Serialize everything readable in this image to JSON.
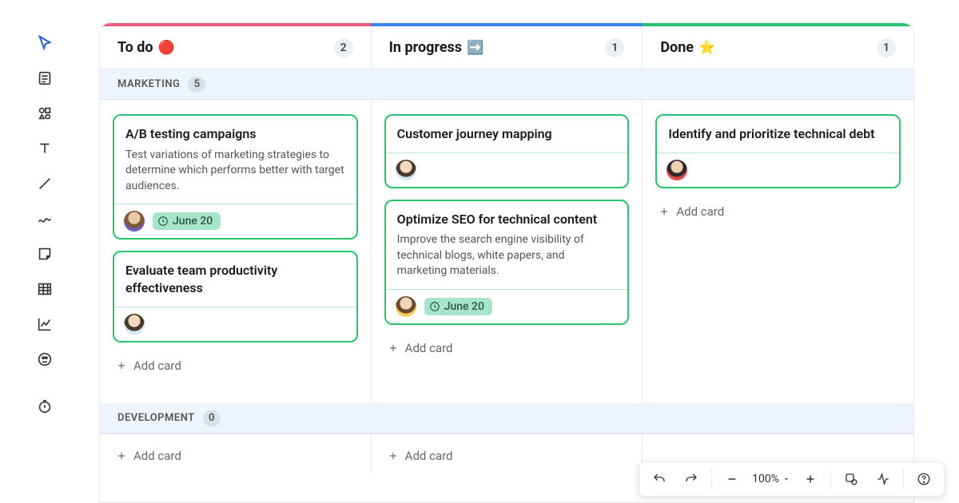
{
  "sidebar": {
    "tools": [
      "cursor",
      "notes",
      "shapes",
      "text",
      "line",
      "draw",
      "sticky",
      "table",
      "chart",
      "stamp",
      "timer"
    ]
  },
  "columns": [
    {
      "title": "To do",
      "emoji": "🔴",
      "count": "2",
      "strip_color": "#ef5b7f"
    },
    {
      "title": "In progress",
      "emoji": "➡️",
      "count": "1",
      "strip_color": "#3a83f5"
    },
    {
      "title": "Done",
      "emoji": "⭐",
      "count": "1",
      "strip_color": "#29c46d"
    }
  ],
  "swimlanes": [
    {
      "title": "MARKETING",
      "count": "5"
    },
    {
      "title": "DEVELOPMENT",
      "count": "0"
    }
  ],
  "cards": {
    "col0": [
      {
        "title": "A/B testing campaigns",
        "desc": "Test variations of marketing strategies to determine which performs better with target audiences.",
        "avatar": "av1",
        "date": "June 20"
      },
      {
        "title": "Evaluate team productivity effectiveness",
        "avatar": "av2"
      }
    ],
    "col1": [
      {
        "title": "Customer journey mapping",
        "avatar": "av2"
      },
      {
        "title": "Optimize SEO for technical content",
        "desc": "Improve the search engine visibility of technical blogs, white papers, and marketing materials.",
        "avatar": "av3",
        "date": "June 20"
      }
    ],
    "col2": [
      {
        "title": "Identify and prioritize technical debt",
        "avatar": "av4"
      }
    ]
  },
  "add_card_label": "Add card",
  "toolbar": {
    "zoom": "100%"
  }
}
